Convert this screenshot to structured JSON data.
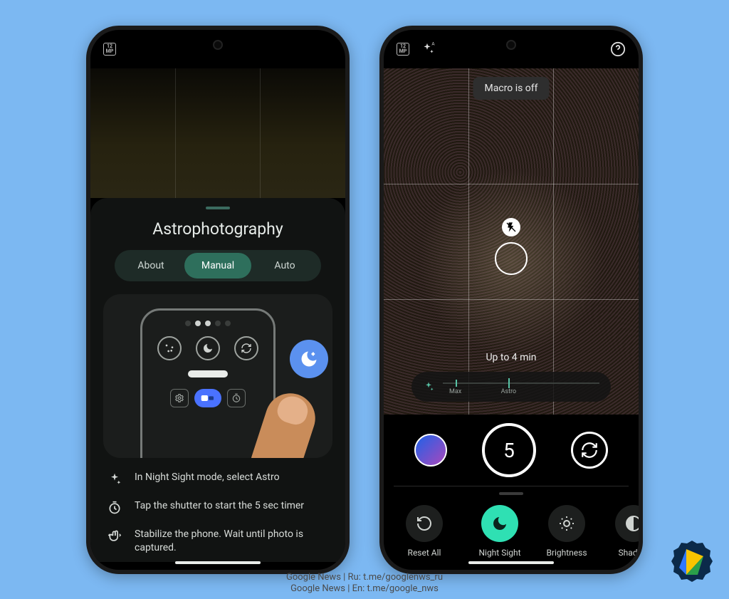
{
  "phone1": {
    "statusbar": {
      "mp": "12\nMP"
    },
    "sheet": {
      "title": "Astrophotography",
      "tabs": {
        "about": "About",
        "manual": "Manual",
        "auto": "Auto",
        "active": "manual"
      },
      "help": {
        "r1": "In Night Sight mode, select Astro",
        "r2": "Tap the shutter to start the 5 sec timer",
        "r3": "Stabilize the phone. Wait until photo is captured."
      }
    }
  },
  "phone2": {
    "statusbar": {
      "mp": "12\nMP"
    },
    "toast": "Macro is off",
    "timer": "Up to 4 min",
    "exposure": {
      "tick1": "Max",
      "tick2": "Astro"
    },
    "shutter_count": "5",
    "adjust": {
      "reset": "Reset All",
      "night": "Night Sight",
      "bright": "Brightness",
      "shadow": "Shadow"
    }
  },
  "caption": {
    "l1": "Google News | Ru: t.me/googlenws_ru",
    "l2": "Google News | En: t.me/google_nws"
  }
}
